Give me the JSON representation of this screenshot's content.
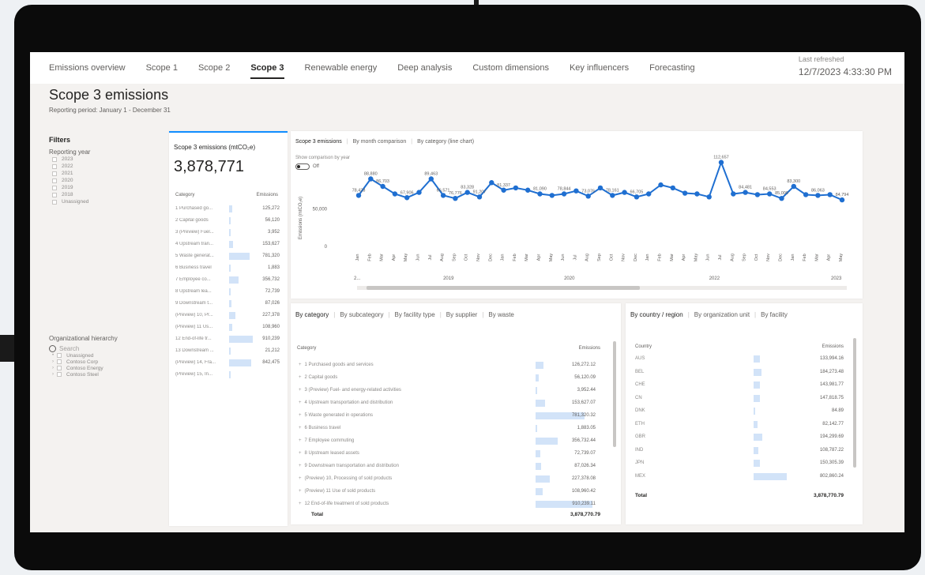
{
  "nav": {
    "tabs": [
      "Emissions overview",
      "Scope 1",
      "Scope 2",
      "Scope 3",
      "Renewable energy",
      "Deep analysis",
      "Custom dimensions",
      "Key influencers",
      "Forecasting"
    ],
    "active_tab": "Scope 3",
    "refresh_label": "Last refreshed",
    "refresh_value": "12/7/2023 4:33:30 PM"
  },
  "page": {
    "title": "Scope 3 emissions",
    "period": "Reporting period: January 1 - December 31"
  },
  "filters": {
    "title": "Filters",
    "year_label": "Reporting year",
    "years": [
      "2023",
      "2022",
      "2021",
      "2020",
      "2019",
      "2018",
      "Unassigned"
    ]
  },
  "hierarchy": {
    "title": "Organizational hierarchy",
    "search_placeholder": "Search",
    "items": [
      "Unassigned",
      "Contoso Corp",
      "Contoso Energy",
      "Contoso Steel"
    ]
  },
  "kpi": {
    "title": "Scope 3 emissions (mtCO₂e)",
    "value": "3,878,771",
    "col_category": "Category",
    "col_emissions": "Emissions",
    "rows": [
      {
        "label": "1 Purchased go...",
        "value": "125,272",
        "share": 0.14
      },
      {
        "label": "2 Capital goods",
        "value": "56,120",
        "share": 0.06
      },
      {
        "label": "3 (Preview) Fuel...",
        "value": "3,952",
        "share": 0.01
      },
      {
        "label": "4 Upstream tran...",
        "value": "153,627",
        "share": 0.17
      },
      {
        "label": "5 Waste generat...",
        "value": "781,320",
        "share": 0.86
      },
      {
        "label": "6 Business travel",
        "value": "1,883",
        "share": 0.01
      },
      {
        "label": "7 Employee co...",
        "value": "356,732",
        "share": 0.39
      },
      {
        "label": "8 Upstream lea...",
        "value": "72,739",
        "share": 0.08
      },
      {
        "label": "9 Downstream t...",
        "value": "87,026",
        "share": 0.1
      },
      {
        "label": "(Preview) 10, Pr...",
        "value": "227,378",
        "share": 0.25
      },
      {
        "label": "(Preview) 11 Us...",
        "value": "108,960",
        "share": 0.12
      },
      {
        "label": "12 End-of-life tr...",
        "value": "910,239",
        "share": 1.0
      },
      {
        "label": "13 Downstream ...",
        "value": "21,212",
        "share": 0.02
      },
      {
        "label": "(Preview) 14, Fra...",
        "value": "842,475",
        "share": 0.93
      },
      {
        "label": "(Preview) 15, In...",
        "value": "",
        "share": 0
      }
    ]
  },
  "trend": {
    "tabs": [
      "Scope 3 emissions",
      "By month comparison",
      "By category (line chart)"
    ],
    "toggle_label": "Show comparison by year",
    "toggle_state": "Off",
    "accent": "#1f6fd1"
  },
  "chart_data": {
    "type": "line",
    "ylabel": "Emissions (mtCO₂e)",
    "y_ticks": [
      "50,000",
      "0"
    ],
    "ylim": [
      0,
      120000
    ],
    "x": [
      "Jan",
      "Feb",
      "Mar",
      "Apr",
      "May",
      "Jun",
      "Jul",
      "Aug",
      "Sep",
      "Oct",
      "Nov",
      "Dec",
      "Jan",
      "Feb",
      "Mar",
      "Apr",
      "May",
      "Jun",
      "Jul",
      "Aug",
      "Sep",
      "Oct",
      "Nov",
      "Dec",
      "Jan",
      "Feb",
      "Mar",
      "Apr",
      "May",
      "Jun",
      "Jul",
      "Aug",
      "Sep",
      "Oct",
      "Nov",
      "Dec",
      "Jan",
      "Feb",
      "Mar",
      "Apr",
      "May"
    ],
    "year_labels": [
      "2...",
      "2019",
      "2020",
      "2022",
      "2023"
    ],
    "series": [
      {
        "values": [
          68000,
          90000,
          80000,
          70000,
          65000,
          72000,
          90000,
          68000,
          64000,
          72000,
          66000,
          85000,
          75000,
          78000,
          75000,
          70000,
          68000,
          70000,
          74000,
          67000,
          78000,
          68000,
          72000,
          66000,
          70000,
          82000,
          78000,
          71000,
          70000,
          66000,
          112000,
          70000,
          72000,
          69000,
          70000,
          64000,
          80000,
          69000,
          68000,
          69000,
          62000
        ],
        "labels": [
          "78,428",
          "88,880",
          "86,703",
          "",
          "67,906",
          "",
          "89,463",
          "66,571",
          "76,776",
          "83,328",
          "91,207",
          "",
          "81,337",
          "",
          "",
          "81,090",
          "",
          "78,844",
          "",
          "73,076",
          "",
          "78,161",
          "",
          "66,705",
          "",
          "",
          "",
          "",
          "",
          "",
          "112,657",
          "",
          "84,481",
          "",
          "84,553",
          "85,009",
          "83,300",
          "",
          "86,063",
          "",
          "84,794"
        ]
      }
    ]
  },
  "category": {
    "tabs": [
      "By category",
      "By subcategory",
      "By facility type",
      "By supplier",
      "By waste"
    ],
    "col_category": "Category",
    "col_emissions": "Emissions",
    "rows": [
      {
        "label": "1 Purchased goods and services",
        "value": "126,272.12",
        "share": 0.14
      },
      {
        "label": "2 Capital goods",
        "value": "56,120.09",
        "share": 0.06
      },
      {
        "label": "3 (Preview) Fuel- and energy-related activities",
        "value": "3,952.44",
        "share": 0.01
      },
      {
        "label": "4 Upstream transportation and distribution",
        "value": "153,627.07",
        "share": 0.17
      },
      {
        "label": "5 Waste generated in operations",
        "value": "781,320.32",
        "share": 0.86
      },
      {
        "label": "6 Business travel",
        "value": "1,883.05",
        "share": 0.01
      },
      {
        "label": "7 Employee commuting",
        "value": "356,732.44",
        "share": 0.39
      },
      {
        "label": "8 Upstream leased assets",
        "value": "72,739.07",
        "share": 0.08
      },
      {
        "label": "9 Downstream transportation and distribution",
        "value": "87,026.34",
        "share": 0.1
      },
      {
        "label": "(Preview) 10, Processing of sold products",
        "value": "227,378.08",
        "share": 0.25
      },
      {
        "label": "(Preview) 11 Use of sold products",
        "value": "108,960.42",
        "share": 0.12
      },
      {
        "label": "12 End-of-life treatment of sold products",
        "value": "910,239.11",
        "share": 1.0
      }
    ],
    "total_label": "Total",
    "total_value": "3,878,770.79"
  },
  "geo": {
    "tabs": [
      "By country / region",
      "By organization unit",
      "By facility"
    ],
    "col_country": "Country",
    "col_emissions": "Emissions",
    "rows": [
      {
        "label": "AUS",
        "value": "133,994.16",
        "share": 0.18
      },
      {
        "label": "BEL",
        "value": "184,273.48",
        "share": 0.24
      },
      {
        "label": "CHE",
        "value": "143,981.77",
        "share": 0.19
      },
      {
        "label": "CN",
        "value": "147,818.75",
        "share": 0.2
      },
      {
        "label": "DNK",
        "value": "84.89",
        "share": 0.0
      },
      {
        "label": "ETH",
        "value": "82,142.77",
        "share": 0.11
      },
      {
        "label": "GBR",
        "value": "194,299.69",
        "share": 0.26
      },
      {
        "label": "IND",
        "value": "108,787.22",
        "share": 0.14
      },
      {
        "label": "JPN",
        "value": "150,305.39",
        "share": 0.2
      },
      {
        "label": "MEX",
        "value": "802,860.24",
        "share": 1.0
      }
    ],
    "total_label": "Total",
    "total_value": "3,878,770.79"
  }
}
